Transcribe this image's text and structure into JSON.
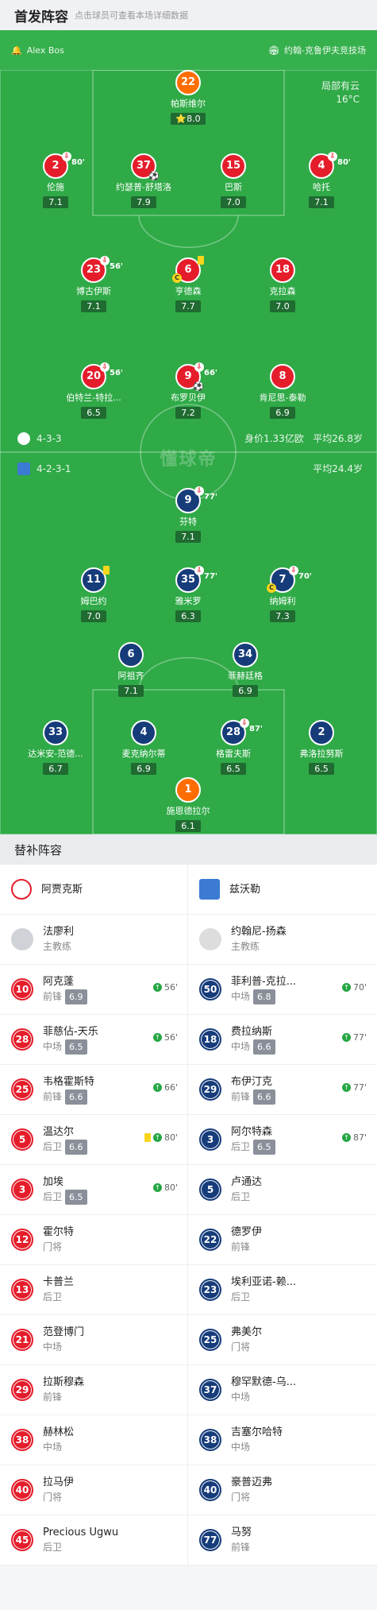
{
  "header": {
    "title": "首发阵容",
    "subtitle": "点击球员可查看本场详细数据"
  },
  "pitch_top": {
    "referee": "Alex Bos",
    "stadium": "约翰-克鲁伊夫竞技场"
  },
  "weather": {
    "condition": "局部有云",
    "temp": "16°C"
  },
  "home_info": {
    "formation": "4-3-3",
    "value": "身价1.33亿欧",
    "avg_age": "平均26.8岁"
  },
  "away_info": {
    "formation": "4-2-3-1",
    "avg_age": "平均24.4岁"
  },
  "watermark": "懂球帝",
  "home_players": [
    {
      "num": "22",
      "name": "帕斯维尔",
      "rating": "8.0"
    },
    {
      "num": "2",
      "name": "伦施",
      "rating": "7.1",
      "sub_min": "80'"
    },
    {
      "num": "37",
      "name": "约瑟普-舒塔洛",
      "rating": "7.9"
    },
    {
      "num": "15",
      "name": "巴斯",
      "rating": "7.0"
    },
    {
      "num": "4",
      "name": "哈托",
      "rating": "7.1",
      "sub_min": "80'"
    },
    {
      "num": "23",
      "name": "博古伊斯",
      "rating": "7.1",
      "sub_min": "56'"
    },
    {
      "num": "6",
      "name": "亨德森",
      "rating": "7.7"
    },
    {
      "num": "18",
      "name": "克拉森",
      "rating": "7.0"
    },
    {
      "num": "20",
      "name": "伯特兰-特拉...",
      "rating": "6.5",
      "sub_min": "56'"
    },
    {
      "num": "9",
      "name": "布罗贝伊",
      "rating": "7.2",
      "sub_min": "66'"
    },
    {
      "num": "8",
      "name": "肯尼思-泰勒",
      "rating": "6.9"
    }
  ],
  "away_players": [
    {
      "num": "9",
      "name": "芬特",
      "rating": "7.1",
      "sub_min": "77'"
    },
    {
      "num": "11",
      "name": "姆巴约",
      "rating": "7.0"
    },
    {
      "num": "35",
      "name": "雅米罗",
      "rating": "6.3",
      "sub_min": "77'"
    },
    {
      "num": "7",
      "name": "纳姆利",
      "rating": "7.3",
      "sub_min": "70'"
    },
    {
      "num": "6",
      "name": "阿祖齐",
      "rating": "7.1"
    },
    {
      "num": "34",
      "name": "菲赫廷格",
      "rating": "6.9"
    },
    {
      "num": "33",
      "name": "达米安-范德...",
      "rating": "6.7"
    },
    {
      "num": "4",
      "name": "麦克纳尔蒂",
      "rating": "6.9"
    },
    {
      "num": "28",
      "name": "格雷夫斯",
      "rating": "6.5",
      "sub_min": "87'"
    },
    {
      "num": "2",
      "name": "弗洛拉努斯",
      "rating": "6.5"
    },
    {
      "num": "1",
      "name": "施恩德拉尔",
      "rating": "6.1"
    }
  ],
  "subs_title": "替补阵容",
  "subs": {
    "home_team": "阿贾克斯",
    "away_team": "兹沃勒",
    "home_coach": {
      "name": "法廖利",
      "role": "主教练"
    },
    "away_coach": {
      "name": "约翰尼-扬森",
      "role": "主教练"
    },
    "home": [
      {
        "num": "10",
        "name": "阿克蓬",
        "pos": "前锋",
        "rating": "6.9",
        "in": "56'"
      },
      {
        "num": "28",
        "name": "菲慈佔-天乐",
        "pos": "中场",
        "rating": "6.5",
        "in": "56'"
      },
      {
        "num": "25",
        "name": "韦格霍斯特",
        "pos": "前锋",
        "rating": "6.6",
        "in": "66'"
      },
      {
        "num": "5",
        "name": "温达尔",
        "pos": "后卫",
        "rating": "6.6",
        "in": "80'"
      },
      {
        "num": "3",
        "name": "加埃",
        "pos": "后卫",
        "rating": "6.5",
        "in": "80'"
      },
      {
        "num": "12",
        "name": "霍尔特",
        "pos": "门将"
      },
      {
        "num": "13",
        "name": "卡普兰",
        "pos": "后卫"
      },
      {
        "num": "21",
        "name": "范登博门",
        "pos": "中场"
      },
      {
        "num": "29",
        "name": "拉斯穆森",
        "pos": "前锋"
      },
      {
        "num": "38",
        "name": "赫林松",
        "pos": "中场"
      },
      {
        "num": "40",
        "name": "拉马伊",
        "pos": "门将"
      },
      {
        "num": "45",
        "name": "Precious Ugwu",
        "pos": "后卫"
      }
    ],
    "away": [
      {
        "num": "50",
        "name": "菲利普-克拉...",
        "pos": "中场",
        "rating": "6.8",
        "in": "70'"
      },
      {
        "num": "18",
        "name": "费拉纳斯",
        "pos": "中场",
        "rating": "6.6",
        "in": "77'"
      },
      {
        "num": "29",
        "name": "布伊汀克",
        "pos": "前锋",
        "rating": "6.6",
        "in": "77'"
      },
      {
        "num": "3",
        "name": "阿尔特森",
        "pos": "后卫",
        "rating": "6.5",
        "in": "87'"
      },
      {
        "num": "5",
        "name": "卢通达",
        "pos": "后卫"
      },
      {
        "num": "22",
        "name": "德罗伊",
        "pos": "前锋"
      },
      {
        "num": "23",
        "name": "埃利亚诺-赖...",
        "pos": "后卫"
      },
      {
        "num": "25",
        "name": "弗美尔",
        "pos": "门将"
      },
      {
        "num": "37",
        "name": "穆罕默德-乌...",
        "pos": "中场"
      },
      {
        "num": "38",
        "name": "吉塞尔哈特",
        "pos": "中场"
      },
      {
        "num": "40",
        "name": "豪普迈弗",
        "pos": "门将"
      },
      {
        "num": "77",
        "name": "马努",
        "pos": "前锋"
      }
    ]
  },
  "colors": {
    "home": "#e51d2b",
    "away": "#163c7a",
    "pitch": "#2faa47",
    "keeper_home": "#ff6d00"
  }
}
